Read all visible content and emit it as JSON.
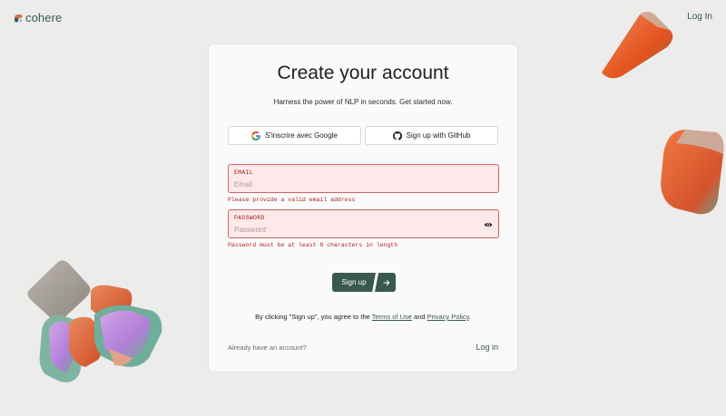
{
  "brand": {
    "name": "cohere",
    "accent": "#39594d",
    "logo_color": "#d6714f"
  },
  "header": {
    "login_label": "Log In"
  },
  "card": {
    "title": "Create your account",
    "subtitle": "Harness the power of NLP in seconds. Get started now.",
    "google_button": {
      "label": "S'inscrire avec Google",
      "icon": "google-icon"
    },
    "github_button": {
      "label": "Sign up with GitHub",
      "icon": "github-icon"
    },
    "email": {
      "label": "EMAIL",
      "placeholder": "Email",
      "value": "",
      "error": "Please provide a valid email address"
    },
    "password": {
      "label": "PASSWORD",
      "placeholder": "Password",
      "value": "",
      "error": "Password must be at least 8 characters in length",
      "toggle_icon": "eye-icon"
    },
    "signup_button": {
      "label": "Sign up",
      "icon": "arrow-right-icon"
    },
    "terms": {
      "prefix": "By clicking \"Sign up\", you agree to the",
      "terms_link": "Terms of Use",
      "and": "and",
      "privacy_link": "Privacy Policy",
      "suffix": "."
    },
    "footer": {
      "have_account": "Already have an account?",
      "login_label": "Log in"
    }
  },
  "colors": {
    "error_red": "#b11f1f",
    "error_bg": "#fde9e9",
    "background": "#ececea"
  }
}
